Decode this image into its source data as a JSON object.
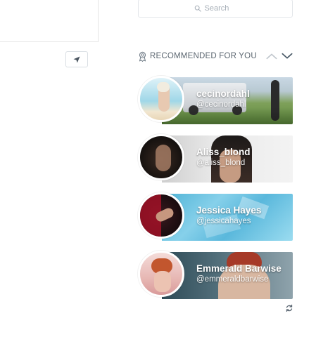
{
  "search": {
    "placeholder": "Search",
    "icon": "search-icon"
  },
  "location_button": {
    "icon": "location-arrow-icon"
  },
  "recommended": {
    "title": "RECOMMENDED FOR YOU",
    "icon": "award-icon",
    "nav": {
      "prev_icon": "chevron-up-icon",
      "next_icon": "chevron-down-icon"
    }
  },
  "creators": [
    {
      "display_name": "cecinordahl",
      "handle": "@cecinordahl"
    },
    {
      "display_name": "Aliss_blond",
      "handle": "@aliss_blond"
    },
    {
      "display_name": "Jessica Hayes",
      "handle": "@jessicahayes"
    },
    {
      "display_name": "Emmerald Barwise",
      "handle": "@emmeraldbarwise"
    }
  ],
  "refresh": {
    "icon": "refresh-icon"
  },
  "colors": {
    "accent": "#8a96a3",
    "header_text": "#5b6670",
    "border": "#e3e6ea"
  }
}
